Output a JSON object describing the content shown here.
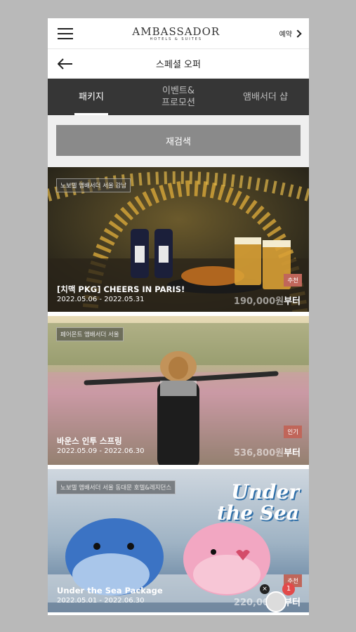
{
  "header": {
    "brand_name": "AMBASSADOR",
    "brand_sub": "HOTELS & SUITES",
    "reserve_label": "예약"
  },
  "subheader": {
    "title": "스페셜 오퍼"
  },
  "tabs": [
    {
      "label": "패키지",
      "active": true
    },
    {
      "label": "이벤트&\n프로모션",
      "active": false
    },
    {
      "label": "앰배서더 샵",
      "active": false
    }
  ],
  "search": {
    "button_label": "재검색"
  },
  "packages": [
    {
      "hotel": "노보텔 앰배서더 서울 강남",
      "title": "[치맥 PKG] CHEERS IN PARIS!",
      "dates": "2022.05.06 - 2022.05.31",
      "badge": "추천",
      "price": "190,000원",
      "price_suffix": "부터"
    },
    {
      "hotel": "페어몬트 앰배서더 서울",
      "title": "바운스 인투 스프링",
      "dates": "2022.05.09 - 2022.06.30",
      "badge": "인기",
      "price": "536,800원",
      "price_suffix": "부터"
    },
    {
      "hotel": "노보텔 앰배서더 서울 동대문 호텔&레지던스",
      "title": "Under the Sea Package",
      "dates": "2022.05.01 - 2022.06.30",
      "badge": "추천",
      "price": "220,000원",
      "price_suffix": "부터",
      "promo_line1": "Under",
      "promo_line2": "the Sea"
    }
  ],
  "chat": {
    "close_glyph": "×",
    "unread_count": "1"
  }
}
